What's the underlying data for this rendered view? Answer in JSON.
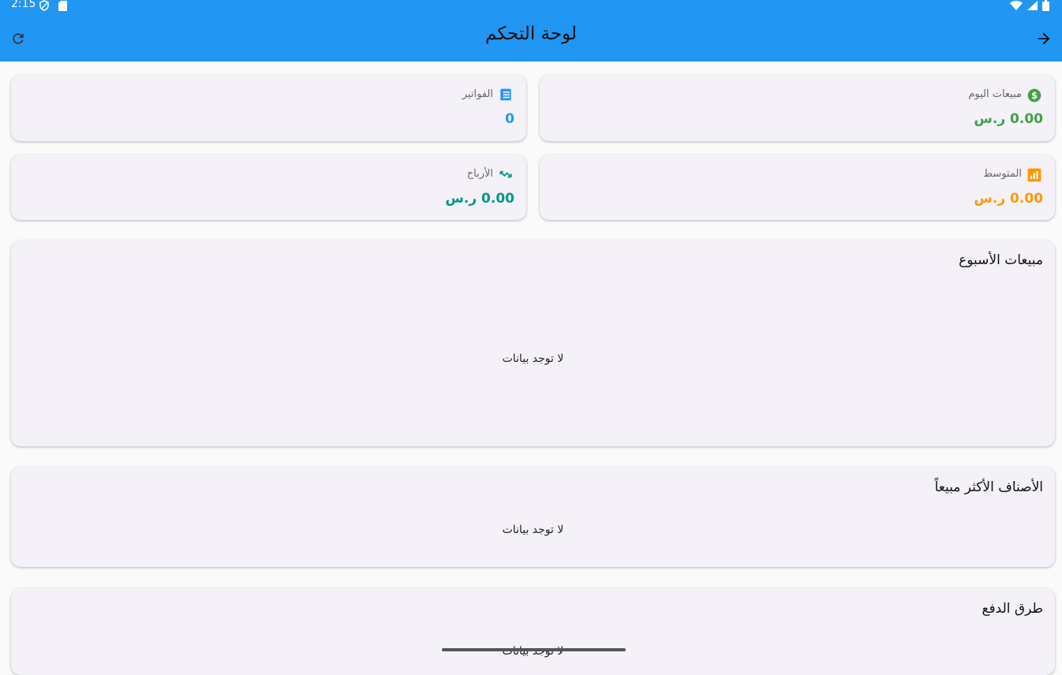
{
  "status_bar": {
    "time": "2:15"
  },
  "app_bar": {
    "title": "لوحة التحكم"
  },
  "stats": {
    "invoices": {
      "label": "الفواتير",
      "value": "0",
      "color": "#2196f3"
    },
    "today_sales": {
      "label": "مبيعات اليوم",
      "value": "0.00 ر.س",
      "color": "#43a047"
    },
    "profits": {
      "label": "الأرباح",
      "value": "0.00 ر.س",
      "color": "#009688"
    },
    "average": {
      "label": "المتوسط",
      "value": "0.00 ر.س",
      "color": "#ff9800"
    }
  },
  "sections": {
    "weekly_sales": {
      "title": "مبيعات الأسبوع",
      "empty": "لا توجد بيانات"
    },
    "top_items": {
      "title": "الأصناف الأكثر مبيعاً",
      "empty": "لا توجد بيانات"
    },
    "payment_methods": {
      "title": "طرق الدفع",
      "empty": "لا توجد بيانات"
    }
  },
  "colors": {
    "app_bar": "#2196f3",
    "card": "#f5f1f8"
  }
}
